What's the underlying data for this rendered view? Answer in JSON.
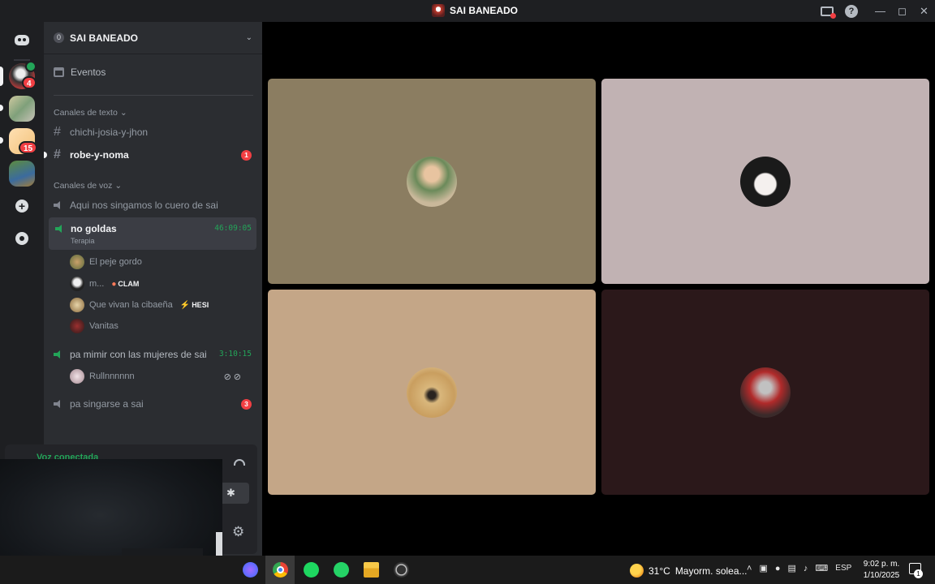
{
  "window": {
    "title": "SAI BANEADO",
    "controls": [
      "minimize",
      "maximize",
      "close"
    ]
  },
  "server_rail": {
    "servers": [
      {
        "name": "server-1",
        "badge": "4",
        "voice_active": true
      },
      {
        "name": "server-2",
        "badge": ""
      },
      {
        "name": "server-3",
        "badge": "15"
      },
      {
        "name": "server-4",
        "badge": ""
      }
    ]
  },
  "guild": {
    "boost_level": "0",
    "name": "SAI BANEADO"
  },
  "events": {
    "label": "Eventos"
  },
  "text_category": {
    "label": "Canales de texto"
  },
  "text_channels": [
    {
      "name": "chichi-josia-y-jhon",
      "unread": false,
      "badge": ""
    },
    {
      "name": "robe-y-noma",
      "unread": true,
      "badge": "1"
    }
  ],
  "voice_category": {
    "label": "Canales de voz"
  },
  "voice_channels": [
    {
      "name": "Aqui nos singamos lo cuero de sai"
    },
    {
      "name": "no goldas",
      "subtitle": "Terapia",
      "timer": "46:09:05"
    },
    {
      "name": "pa mimir con las mujeres de sai",
      "timer": "3:10:15"
    },
    {
      "name": "pa singarse a sai",
      "badge": "3"
    }
  ],
  "voice_users_no_goldas": [
    {
      "name": "El peje gordo",
      "tag": ""
    },
    {
      "name": "m...",
      "tag": "CLAM",
      "tag_icon": "fire-icon"
    },
    {
      "name": "Que vivan la cibaeña",
      "tag": "HESI",
      "tag_icon": "bolt-icon"
    },
    {
      "name": "Vanitas",
      "tag": ""
    }
  ],
  "voice_users_mimir": [
    {
      "name": "Rullnnnnnn",
      "muted": true,
      "deafened": true
    }
  ],
  "voice_panel": {
    "status": "Voz conectada"
  },
  "video_tiles": [
    {
      "user": "El peje gordo",
      "color": "#8b7d61"
    },
    {
      "user": "m...",
      "color": "#c1b2b3"
    },
    {
      "user": "Que vivan la cibaeña",
      "color": "#c4a687"
    },
    {
      "user": "Vanitas",
      "color": "#2b181a"
    }
  ],
  "taskbar": {
    "apps": [
      "messenger-icon",
      "chrome-icon",
      "spotify-icon",
      "whatsapp-icon",
      "file-explorer-icon",
      "obs-icon"
    ],
    "weather_temp": "31°C",
    "weather_text": "Mayorm. solea...",
    "language": "ESP",
    "time": "9:02 p. m.",
    "date": "1/10/2025",
    "notification_count": "1"
  },
  "colors": {
    "accent_green": "#23a559",
    "badge_red": "#f23f43"
  }
}
